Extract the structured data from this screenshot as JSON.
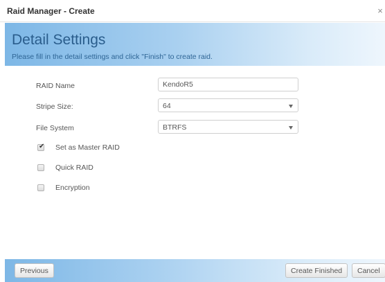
{
  "window": {
    "title": "Raid Manager - Create",
    "close_glyph": "×"
  },
  "header": {
    "title": "Detail Settings",
    "subtitle": "Please fill in the detail settings and click \"Finish\" to create raid."
  },
  "form": {
    "raid_name": {
      "label": "RAID Name",
      "value": "KendoR5"
    },
    "stripe_size": {
      "label": "Stripe Size:",
      "value": "64"
    },
    "file_system": {
      "label": "File System",
      "value": "BTRFS"
    }
  },
  "options": {
    "master": {
      "label": "Set as Master RAID",
      "checked": true,
      "tick": "✔"
    },
    "quick": {
      "label": "Quick RAID",
      "checked": false
    },
    "encryption": {
      "label": "Encryption",
      "checked": false
    }
  },
  "footer": {
    "previous": "Previous",
    "create": "Create Finished",
    "cancel": "Cancel"
  },
  "colors": {
    "header_gradient_start": "#7db7e6",
    "header_title": "#2a5d8c"
  }
}
